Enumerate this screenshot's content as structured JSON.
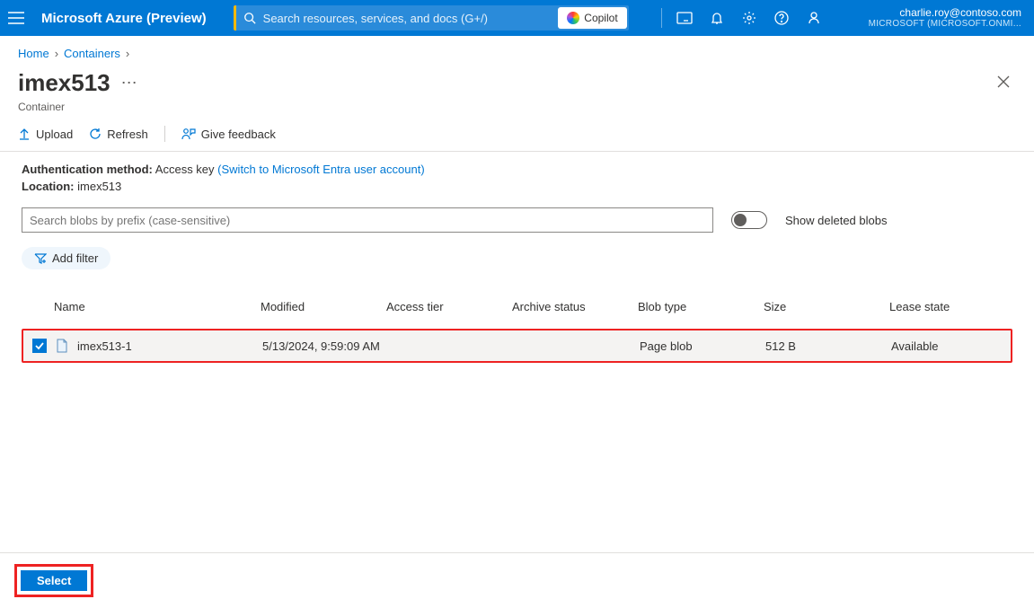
{
  "topbar": {
    "brand": "Microsoft Azure (Preview)",
    "search_placeholder": "Search resources, services, and docs (G+/)",
    "copilot_label": "Copilot",
    "account_email": "charlie.roy@contoso.com",
    "account_tenant": "MICROSOFT (MICROSOFT.ONMI..."
  },
  "breadcrumbs": {
    "items": [
      "Home",
      "Containers"
    ]
  },
  "page": {
    "title": "imex513",
    "subtitle": "Container"
  },
  "commands": {
    "upload": "Upload",
    "refresh": "Refresh",
    "feedback": "Give feedback"
  },
  "info": {
    "auth_label": "Authentication method:",
    "auth_value": "Access key",
    "auth_link": "(Switch to Microsoft Entra user account)",
    "loc_label": "Location:",
    "loc_value": "imex513"
  },
  "filters": {
    "prefix_placeholder": "Search blobs by prefix (case-sensitive)",
    "show_deleted_label": "Show deleted blobs",
    "add_filter_label": "Add filter"
  },
  "table": {
    "columns": [
      "Name",
      "Modified",
      "Access tier",
      "Archive status",
      "Blob type",
      "Size",
      "Lease state"
    ],
    "rows": [
      {
        "name": "imex513-1",
        "modified": "5/13/2024, 9:59:09 AM",
        "access_tier": "",
        "archive_status": "",
        "blob_type": "Page blob",
        "size": "512 B",
        "lease_state": "Available",
        "selected": true
      }
    ]
  },
  "footer": {
    "select_label": "Select"
  }
}
